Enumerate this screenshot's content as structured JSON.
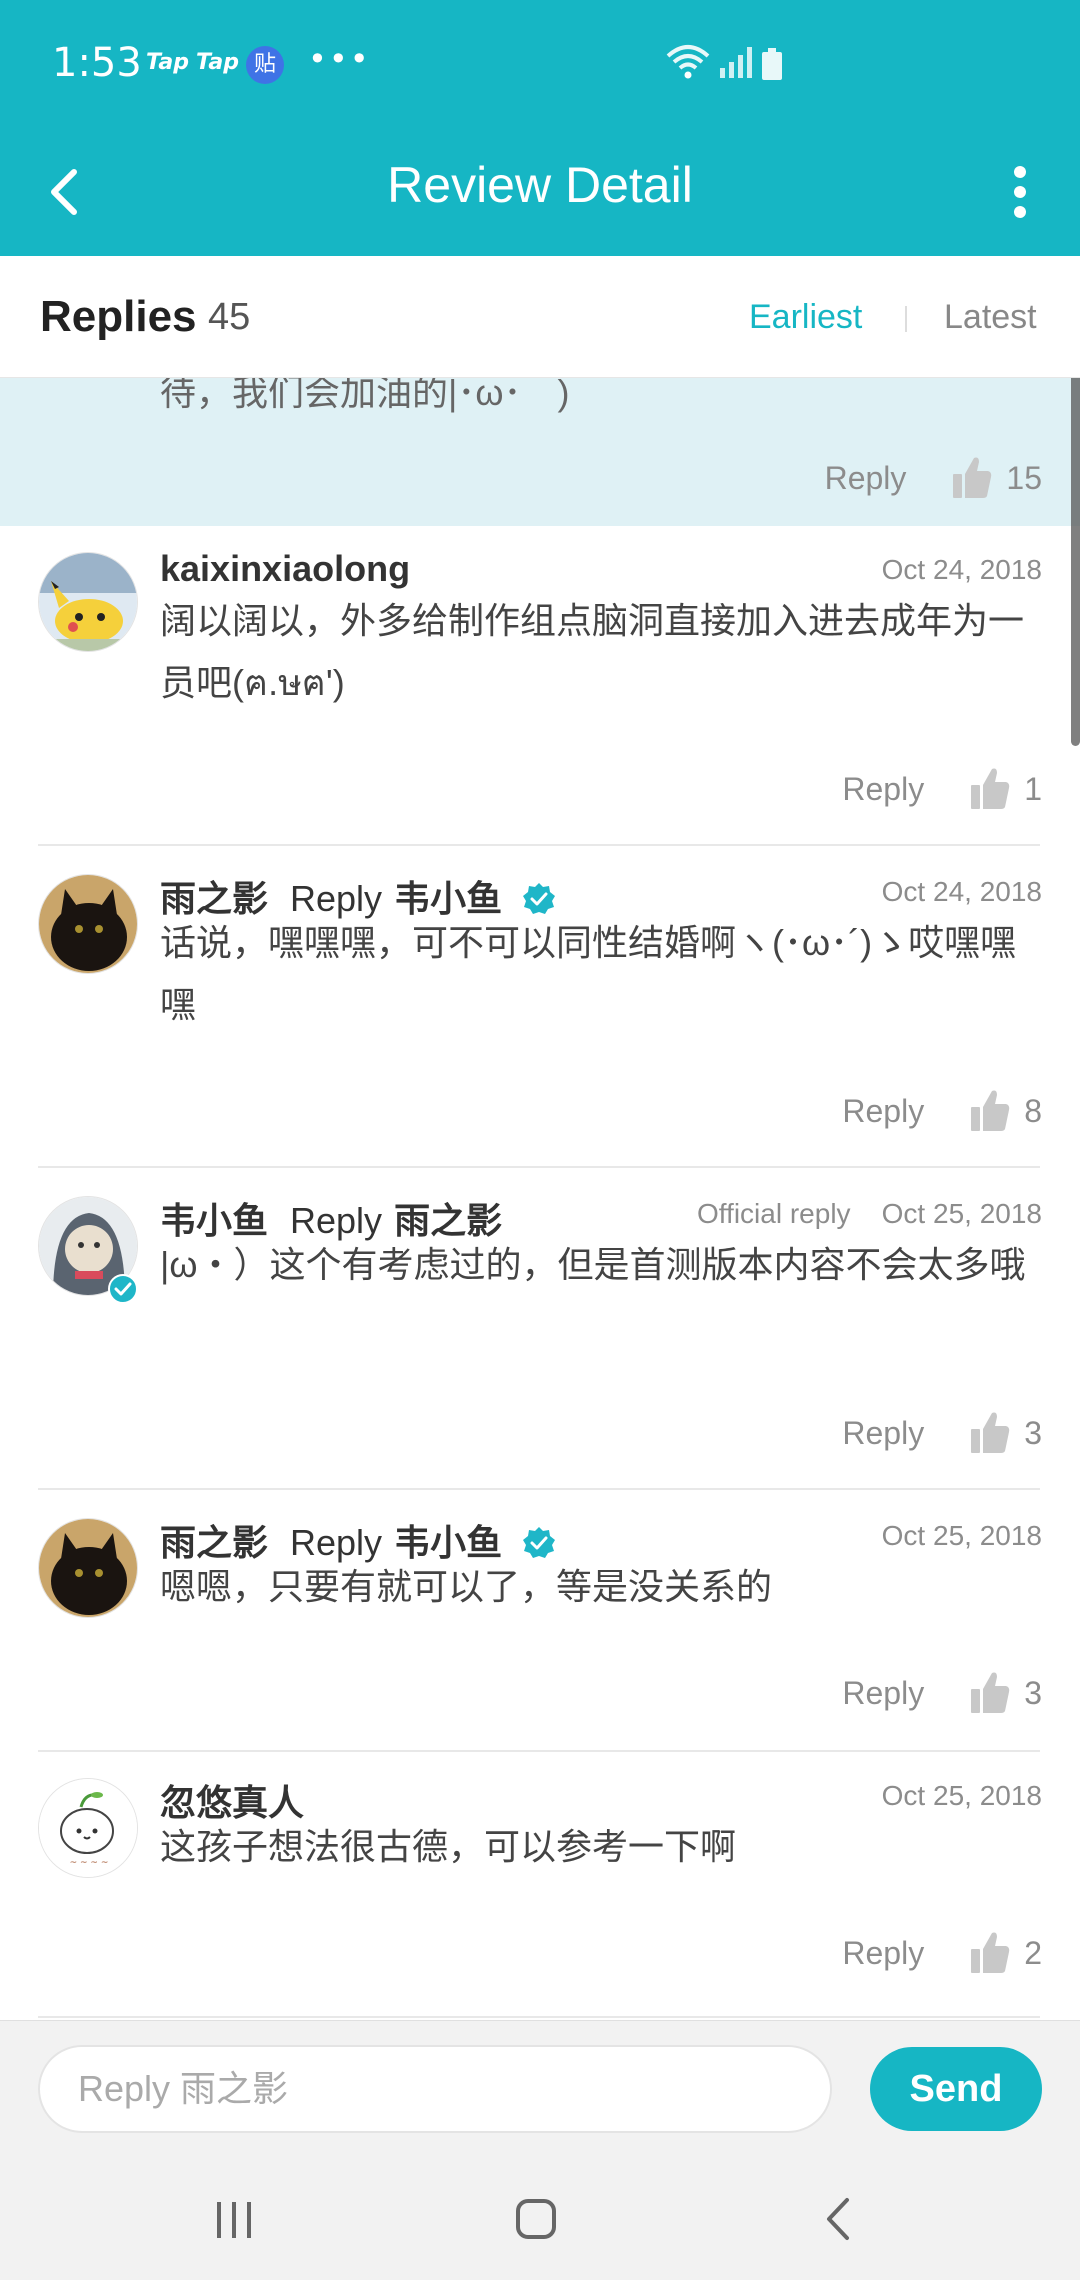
{
  "status_bar": {
    "time": "1:53",
    "app_icons": [
      "Tap",
      "Tap"
    ],
    "tieba_glyph": "贴",
    "more_dots": "• • •"
  },
  "header": {
    "title": "Review Detail"
  },
  "replies_header": {
    "title": "Replies",
    "count": "45",
    "sort_earliest": "Earliest",
    "sort_latest": "Latest",
    "active_sort": "Earliest"
  },
  "highlight": {
    "partial_text": "待，我们会加油的|･ω･｀)",
    "reply_label": "Reply",
    "likes": "15"
  },
  "comments": [
    {
      "author": "kaixinxiaolong",
      "reply_word": "",
      "target": "",
      "date": "Oct 24, 2018",
      "official": "",
      "text": "阔以阔以，外多给制作组点脑洞直接加入进去成年为一员吧(ฅ.ษฅ')",
      "reply_label": "Reply",
      "likes": "1"
    },
    {
      "author": "雨之影",
      "reply_word": "Reply",
      "target": "韦小鱼",
      "date": "Oct 24, 2018",
      "official": "",
      "text": "话说，嘿嘿嘿，可不可以同性结婚啊ヽ(･ω･´)ゝ哎嘿嘿嘿",
      "reply_label": "Reply",
      "likes": "8"
    },
    {
      "author": "韦小鱼",
      "reply_word": "Reply",
      "target": "雨之影",
      "date": "Oct 25, 2018",
      "official": "Official reply",
      "text": "|ω・）这个有考虑过的，但是首测版本内容不会太多哦",
      "reply_label": "Reply",
      "likes": "3"
    },
    {
      "author": "雨之影",
      "reply_word": "Reply",
      "target": "韦小鱼",
      "date": "Oct 25, 2018",
      "official": "",
      "text": "嗯嗯，只要有就可以了，等是没关系的",
      "reply_label": "Reply",
      "likes": "3"
    },
    {
      "author": "忽悠真人",
      "reply_word": "",
      "target": "",
      "date": "Oct 25, 2018",
      "official": "",
      "text": "这孩子想法很古德，可以参考一下啊",
      "reply_label": "Reply",
      "likes": "2"
    }
  ],
  "input": {
    "placeholder": "Reply 雨之影",
    "value": "",
    "send_label": "Send"
  },
  "colors": {
    "accent": "#16b6c4",
    "highlight_bg": "#dff1f5",
    "verified": "#1fb6c8"
  }
}
